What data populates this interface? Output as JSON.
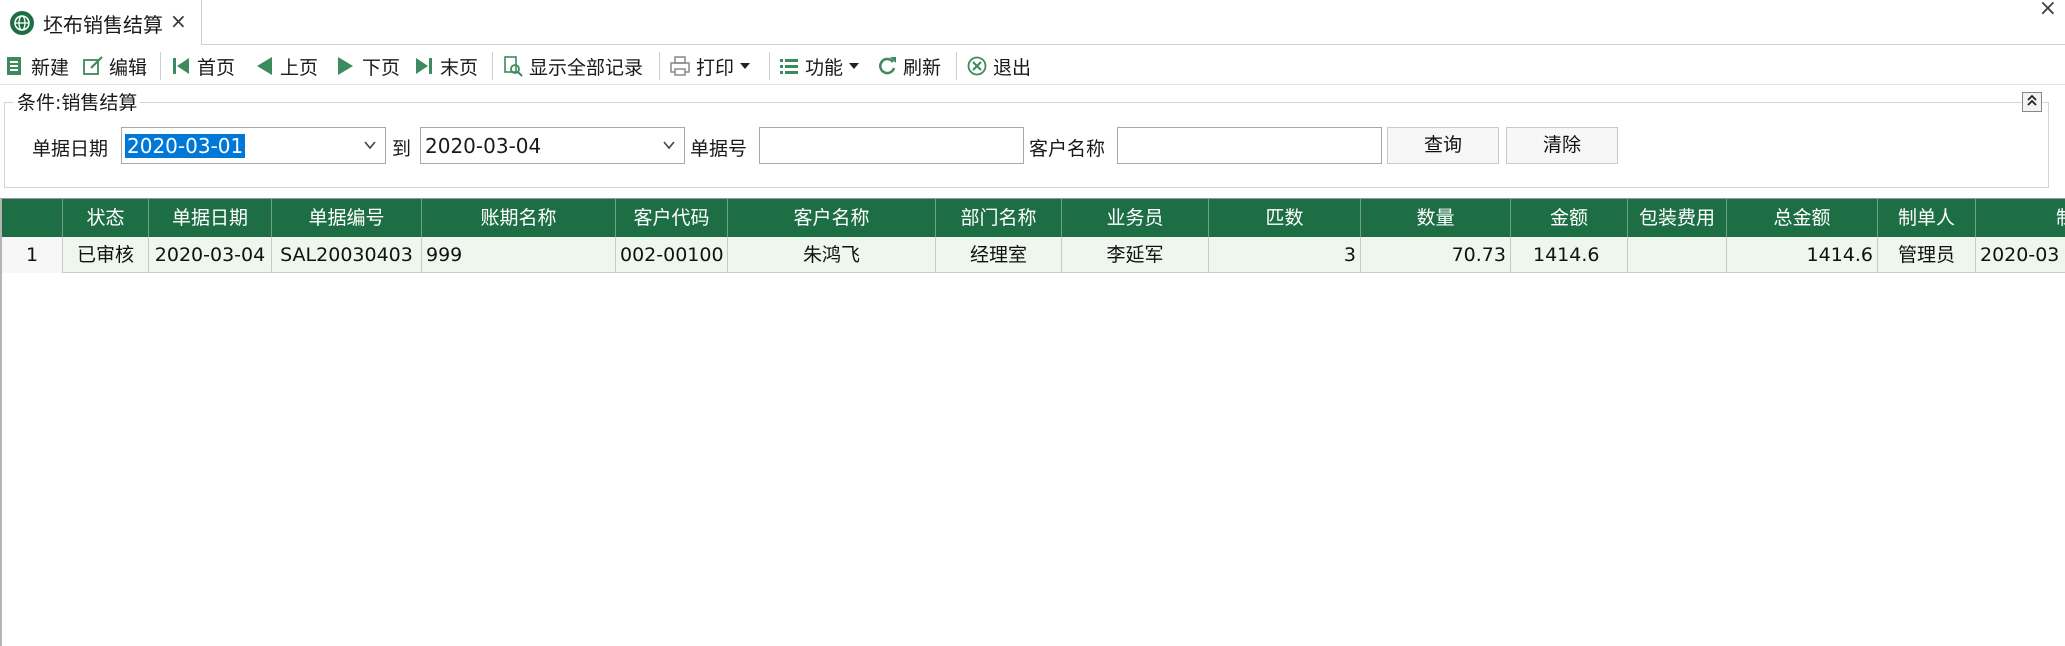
{
  "tab": {
    "title": "坯布销售结算",
    "close": "×",
    "window_close": "×"
  },
  "toolbar": {
    "new": "新建",
    "edit": "编辑",
    "first": "首页",
    "prev": "上页",
    "next": "下页",
    "last": "末页",
    "show_all": "显示全部记录",
    "print": "打印",
    "functions": "功能",
    "refresh": "刷新",
    "exit": "退出"
  },
  "conditions": {
    "title": "条件:销售结算",
    "date_label": "单据日期",
    "date_from": "2020-03-01",
    "to_label": "到",
    "date_to": "2020-03-04",
    "doc_no_label": "单据号",
    "doc_no_value": "",
    "customer_label": "客户名称",
    "customer_value": "",
    "query_button": "查询",
    "clear_button": "清除"
  },
  "grid": {
    "headers": [
      "",
      "状态",
      "单据日期",
      "单据编号",
      "账期名称",
      "客户代码",
      "客户名称",
      "部门名称",
      "业务员",
      "匹数",
      "数量",
      "金额",
      "包装费用",
      "总金额",
      "制单人",
      "制"
    ],
    "rows": [
      [
        "1",
        "已审核",
        "2020-03-04",
        "SAL20030403",
        "999",
        "002-00100",
        "朱鸿飞",
        "经理室",
        "李延军",
        "3",
        "70.73",
        "1414.6",
        "",
        "1414.6",
        "管理员",
        "2020-03"
      ]
    ]
  },
  "colors": {
    "header_bg": "#1e6e45",
    "row_bg": "#eef6ee",
    "selection": "#0078d7"
  }
}
